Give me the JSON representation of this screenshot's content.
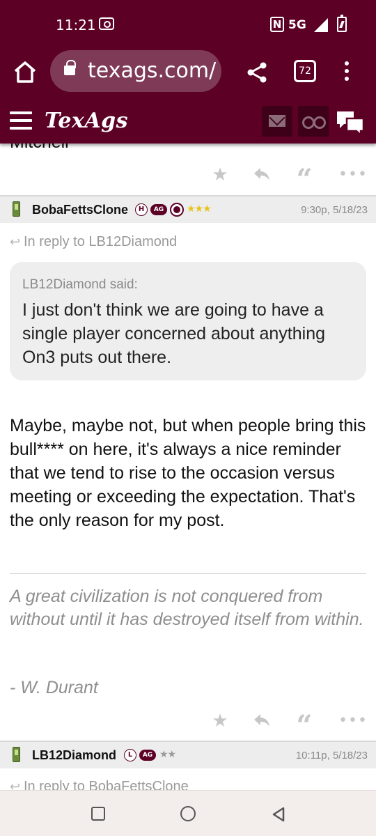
{
  "status_bar": {
    "time": "11:21",
    "network": "5G",
    "icons": [
      "cast-icon",
      "nfc-icon",
      "signal-icon",
      "battery-charging-icon"
    ]
  },
  "browser": {
    "url": "texags.com/",
    "tab_count": "72",
    "icons": [
      "home-icon",
      "lock-icon",
      "share-icon",
      "tabs-icon",
      "overflow-menu-icon"
    ]
  },
  "site": {
    "logo": "TexAgs",
    "brand_color": "#5d0025",
    "icons": [
      "hamburger-icon",
      "mail-icon",
      "binoculars-icon",
      "chat-bubbles-icon"
    ]
  },
  "content": {
    "cut_off_text": "Mitchell",
    "post_actions": [
      "star-icon",
      "reply-icon",
      "quote-icon",
      "more-icon"
    ],
    "post1": {
      "username": "BobaFettsClone",
      "badge_letter": "H",
      "badge_ag": "AG",
      "stars": "★★★",
      "star_color": "#e8c21c",
      "timestamp": "9:30p, 5/18/23",
      "in_reply_to": "In reply to LB12Diamond",
      "quote_author": "LB12Diamond said:",
      "quote_text": "I just don't think we are going to have a single player concerned about anything On3 puts out there.",
      "body": "Maybe, maybe not, but when people bring this bull**** on here, it's always a nice reminder that we tend to rise to the occasion versus meeting or exceeding the expectation. That's the only reason for my post.",
      "signature": "A great civilization is not conquered from without until it has destroyed itself from within.",
      "signature_author": "- W. Durant"
    },
    "post2": {
      "username": "LB12Diamond",
      "badge_letter": "L",
      "badge_ag": "AG",
      "stars": "★★",
      "star_color": "#9a9a9a",
      "timestamp": "10:11p, 5/18/23",
      "in_reply_to": "In reply to BobaFettsClone"
    }
  },
  "nav_bar": {
    "icons": [
      "recents-icon",
      "home-circle-icon",
      "back-icon"
    ]
  }
}
